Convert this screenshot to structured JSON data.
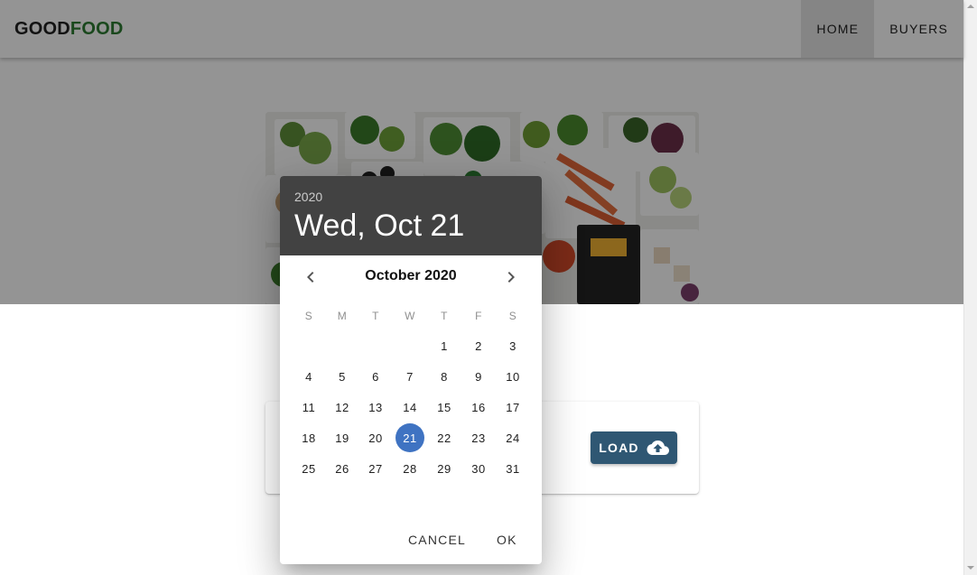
{
  "app": {
    "brand_part1": "GOOD",
    "brand_part2": "FOOD"
  },
  "nav": {
    "items": [
      {
        "label": "HOME",
        "active": true
      },
      {
        "label": "BUYERS",
        "active": false
      }
    ]
  },
  "card": {
    "load_label": "LOAD",
    "load_icon": "cloud-upload-icon"
  },
  "date_picker": {
    "year": "2020",
    "selected_date": "Wed, Oct 21",
    "month_label": "October 2020",
    "weekdays": [
      "S",
      "M",
      "T",
      "W",
      "T",
      "F",
      "S"
    ],
    "days": [
      1,
      2,
      3,
      4,
      5,
      6,
      7,
      8,
      9,
      10,
      11,
      12,
      13,
      14,
      15,
      16,
      17,
      18,
      19,
      20,
      21,
      22,
      23,
      24,
      25,
      26,
      27,
      28,
      29,
      30,
      31
    ],
    "selected_day": 21,
    "prev_icon": "chevron-left-icon",
    "next_icon": "chevron-right-icon",
    "cancel_label": "CANCEL",
    "ok_label": "OK"
  },
  "colors": {
    "brand_green": "#2e7d32",
    "button_blue": "#2f5773",
    "header_dark": "#424242",
    "selected_day": "#3f73c2"
  }
}
